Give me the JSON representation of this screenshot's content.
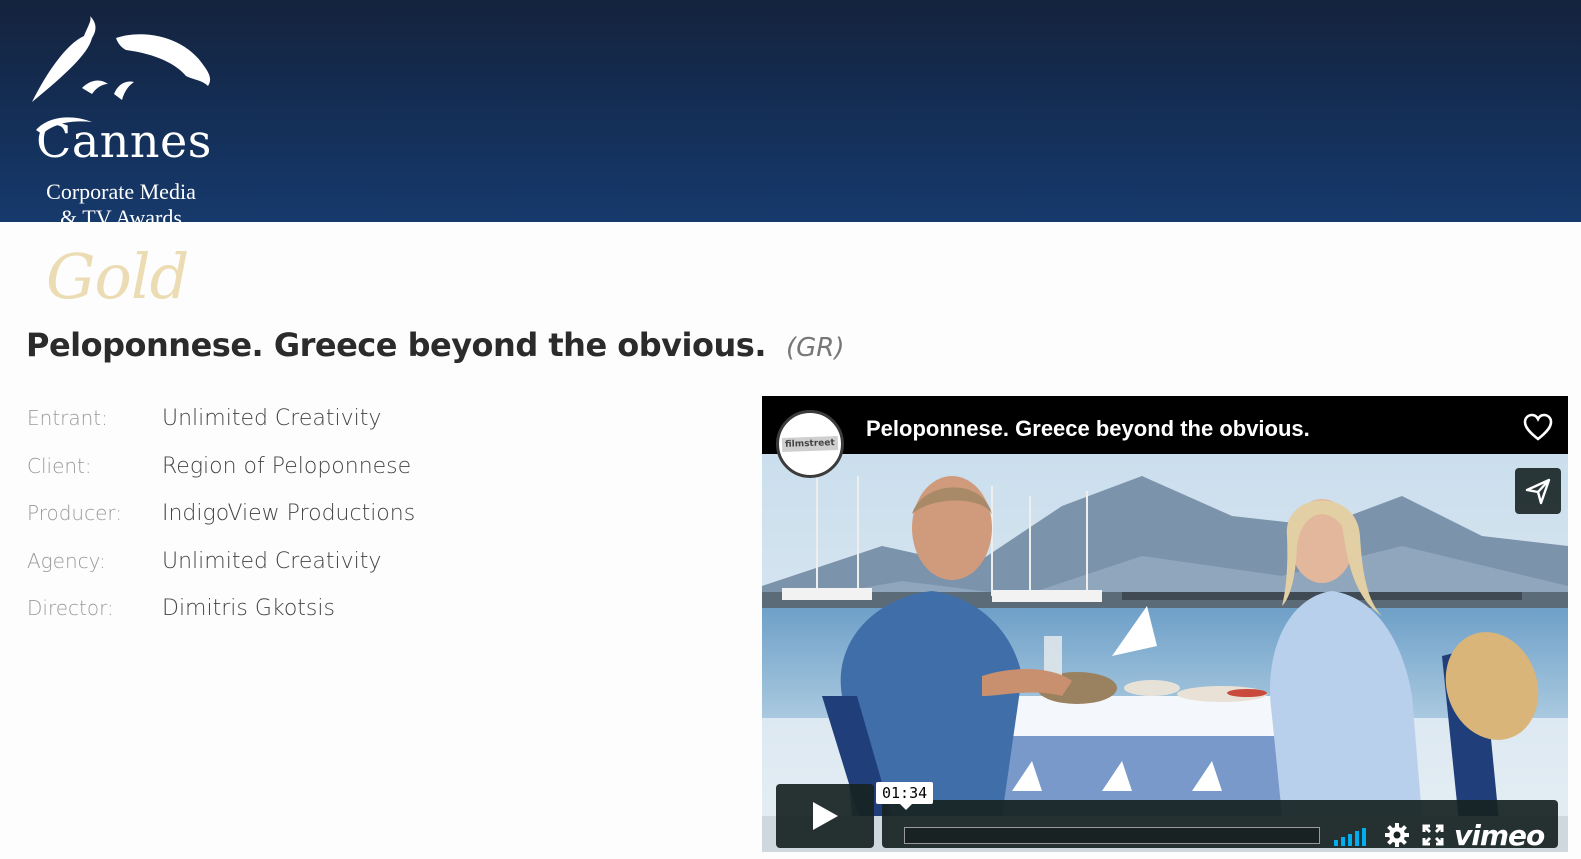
{
  "header": {
    "logo": {
      "line1": "Cannes",
      "line2": "Corporate Media",
      "line3": "& TV Awards",
      "icon": "dolphin-icon"
    },
    "background_color": "#14305a"
  },
  "award": {
    "level": "Gold",
    "title": "Peloponnese. Greece beyond the obvious.",
    "country": "(GR)"
  },
  "credits": [
    {
      "label": "Entrant:",
      "value": "Unlimited Creativity"
    },
    {
      "label": "Client:",
      "value": "Region of Peloponnese"
    },
    {
      "label": "Producer:",
      "value": "IndigoView Productions"
    },
    {
      "label": "Agency:",
      "value": "Unlimited Creativity"
    },
    {
      "label": "Director:",
      "value": "Dimitris Gkotsis"
    }
  ],
  "player": {
    "video_title": "Peloponnese. Greece beyond the obvious.",
    "channel_logo_text": "filmstreet",
    "time": "01:34",
    "progress": 0.0,
    "brand": "vimeo",
    "accent_color": "#00adef",
    "icons": {
      "like": "heart-icon",
      "share": "send-icon",
      "play": "play-icon",
      "volume": "volume-bars-icon",
      "settings": "gear-icon",
      "fullscreen": "fullscreen-icon"
    }
  }
}
